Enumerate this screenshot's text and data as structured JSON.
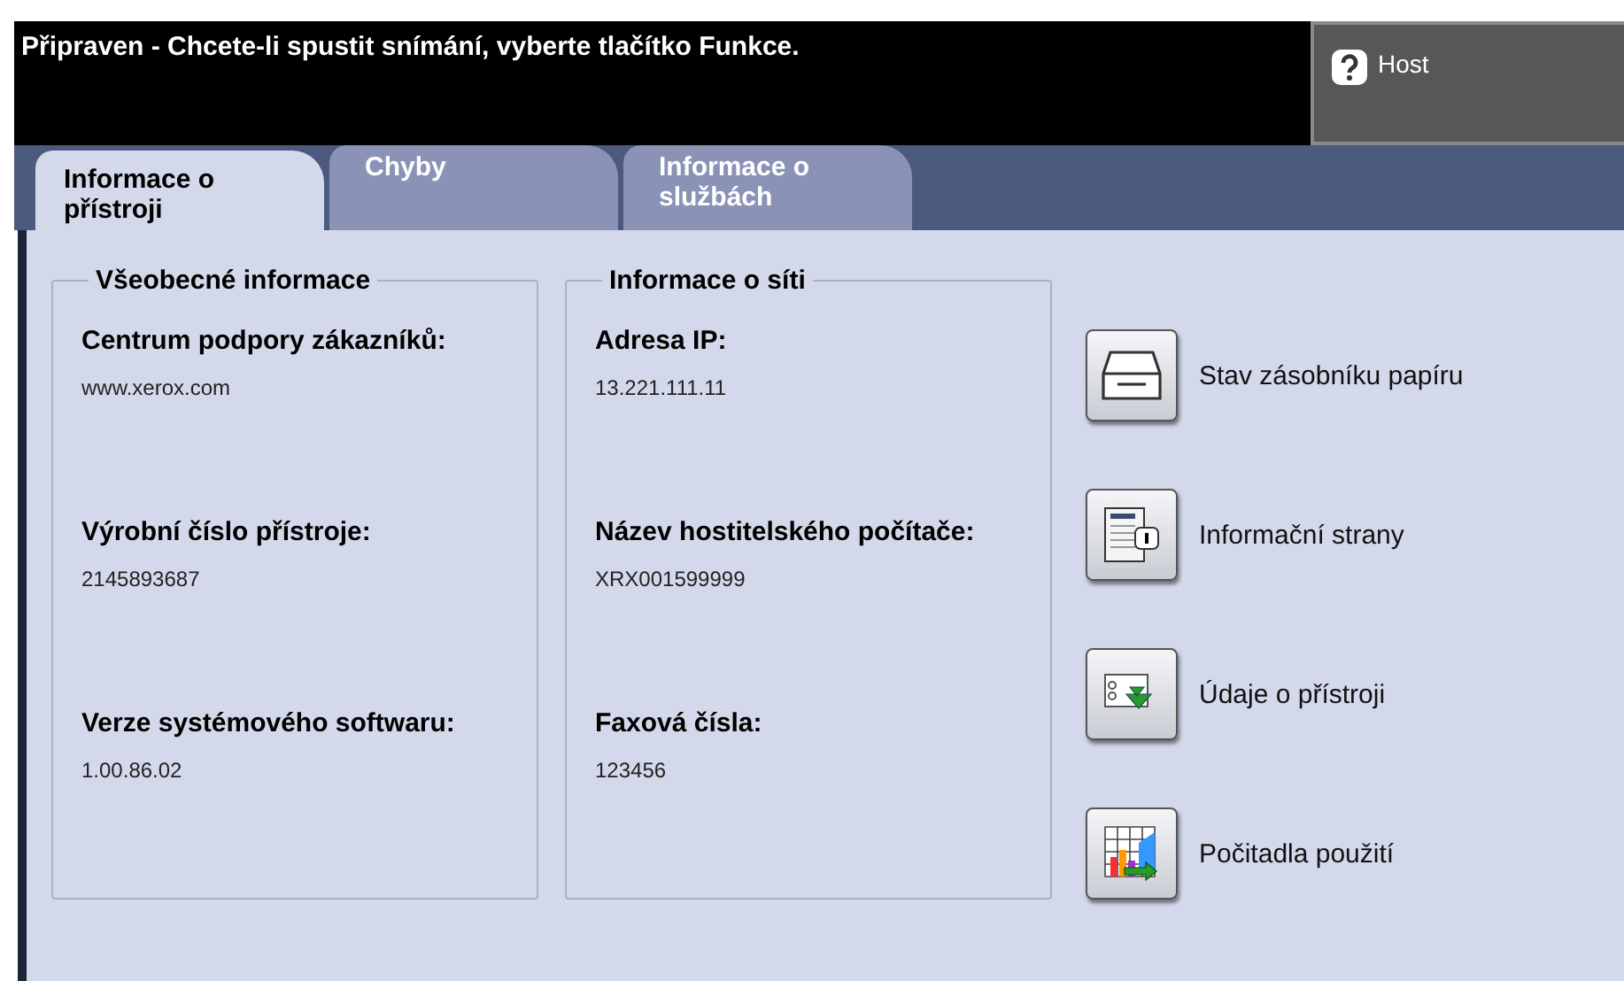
{
  "status_message": "Připraven - Chcete-li spustit snímání, vyberte tlačítko Funkce.",
  "host_button": {
    "label": "Host"
  },
  "tabs": [
    {
      "label": "Informace o přístroji",
      "selected": true
    },
    {
      "label": "Chyby",
      "selected": false
    },
    {
      "label": "Informace o službách",
      "selected": false
    }
  ],
  "sections": [
    {
      "title": "Všeobecné informace",
      "fields": [
        {
          "label": "Centrum podpory zákazníků:",
          "value": "www.xerox.com"
        },
        {
          "label": "Výrobní číslo přístroje:",
          "value": "2145893687"
        },
        {
          "label": "Verze systémového softwaru:",
          "value": "1.00.86.02"
        }
      ]
    },
    {
      "title": "Informace o síti",
      "fields": [
        {
          "label": "Adresa IP:",
          "value": "13.221.111.11"
        },
        {
          "label": "Název hostitelského počítače:",
          "value": "XRX001599999"
        },
        {
          "label": "Faxová čísla:",
          "value": "123456"
        }
      ]
    }
  ],
  "actions": [
    {
      "kind": "tray",
      "label": "Stav zásobníku papíru"
    },
    {
      "kind": "pages",
      "label": "Informační strany"
    },
    {
      "kind": "details",
      "label": "Údaje o přístroji"
    },
    {
      "kind": "counters",
      "label": "Počitadla použití"
    }
  ]
}
